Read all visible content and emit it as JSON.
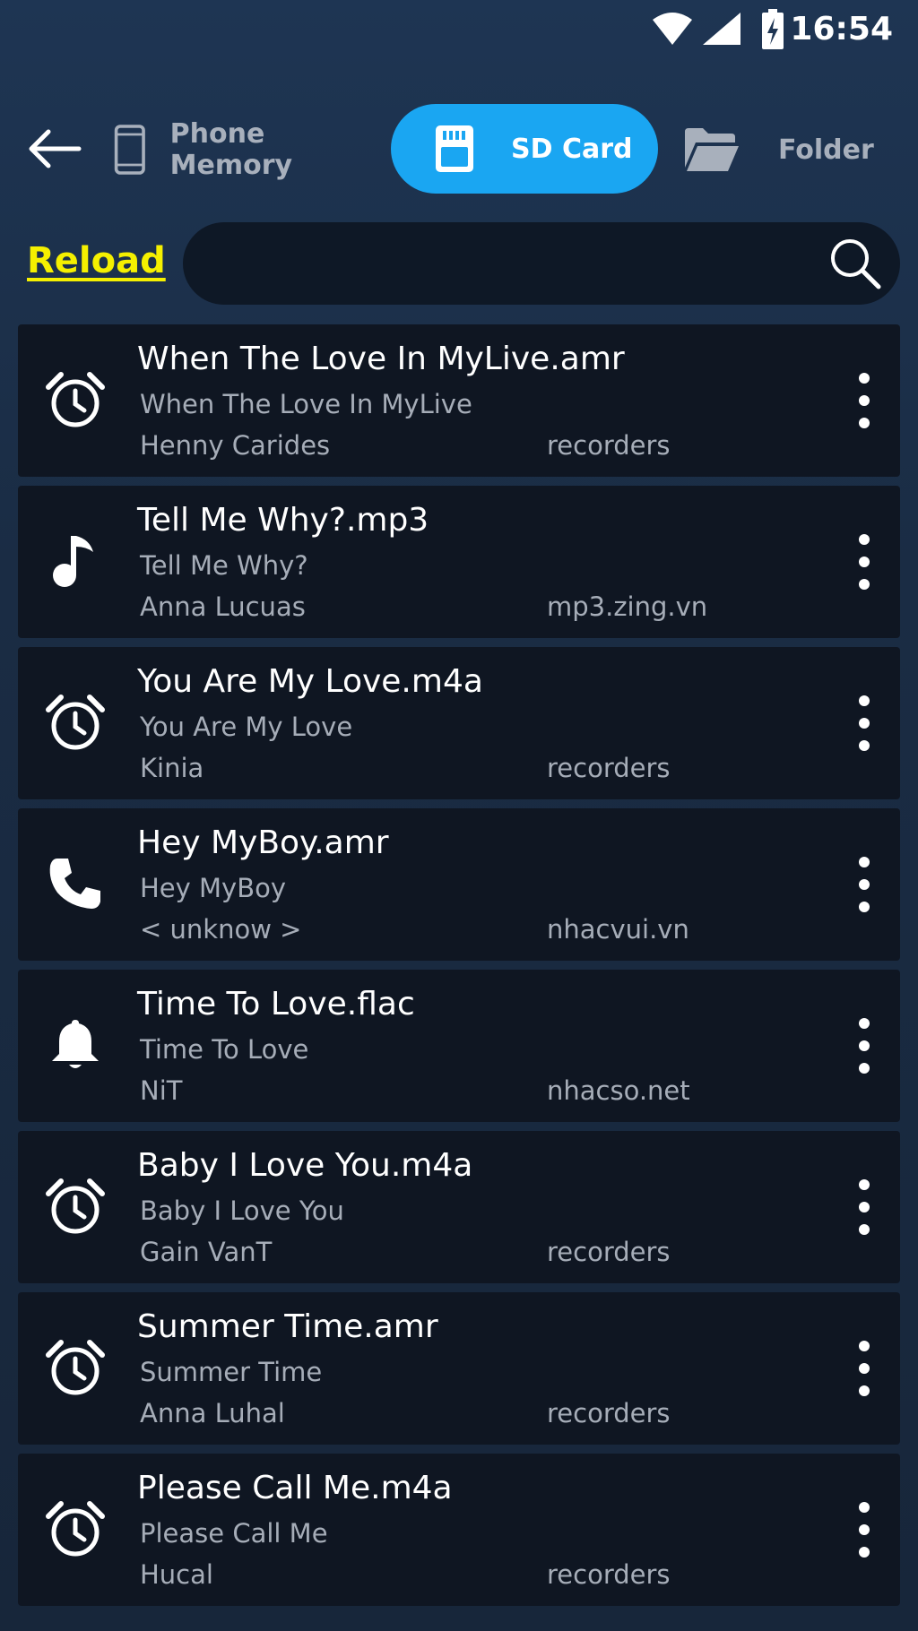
{
  "status_bar": {
    "time": "16:54"
  },
  "nav": {
    "tabs": [
      {
        "label": "Phone Memory",
        "active": false
      },
      {
        "label": "SD Card",
        "active": true
      },
      {
        "label": "Folder",
        "active": false
      }
    ]
  },
  "search": {
    "reload_label": "Reload",
    "value": "",
    "placeholder": ""
  },
  "colors": {
    "accent": "#1aa6f2",
    "reload": "#f5f000",
    "row_bg": "#0f1622"
  },
  "items": [
    {
      "icon": "alarm-icon",
      "title": "When The Love In MyLive.amr",
      "subtitle": "When The Love In MyLive",
      "artist": "Henny Carides",
      "source": "recorders"
    },
    {
      "icon": "music-note-icon",
      "title": "Tell Me Why?.mp3",
      "subtitle": "Tell Me Why?",
      "artist": "Anna Lucuas",
      "source": "mp3.zing.vn"
    },
    {
      "icon": "alarm-icon",
      "title": "You Are My Love.m4a",
      "subtitle": "You Are My Love",
      "artist": "Kinia",
      "source": "recorders"
    },
    {
      "icon": "phone-icon",
      "title": "Hey MyBoy.amr",
      "subtitle": "Hey MyBoy",
      "artist": "< unknow >",
      "source": "nhacvui.vn"
    },
    {
      "icon": "bell-icon",
      "title": "Time To Love.flac",
      "subtitle": "Time To Love",
      "artist": "NiT",
      "source": "nhacso.net"
    },
    {
      "icon": "alarm-icon",
      "title": "Baby I Love You.m4a",
      "subtitle": "Baby I Love You",
      "artist": "Gain VanT",
      "source": "recorders"
    },
    {
      "icon": "alarm-icon",
      "title": "Summer Time.amr",
      "subtitle": "Summer Time",
      "artist": "Anna Luhal",
      "source": "recorders"
    },
    {
      "icon": "alarm-icon",
      "title": "Please Call Me.m4a",
      "subtitle": "Please Call Me",
      "artist": "Hucal",
      "source": "recorders"
    }
  ]
}
